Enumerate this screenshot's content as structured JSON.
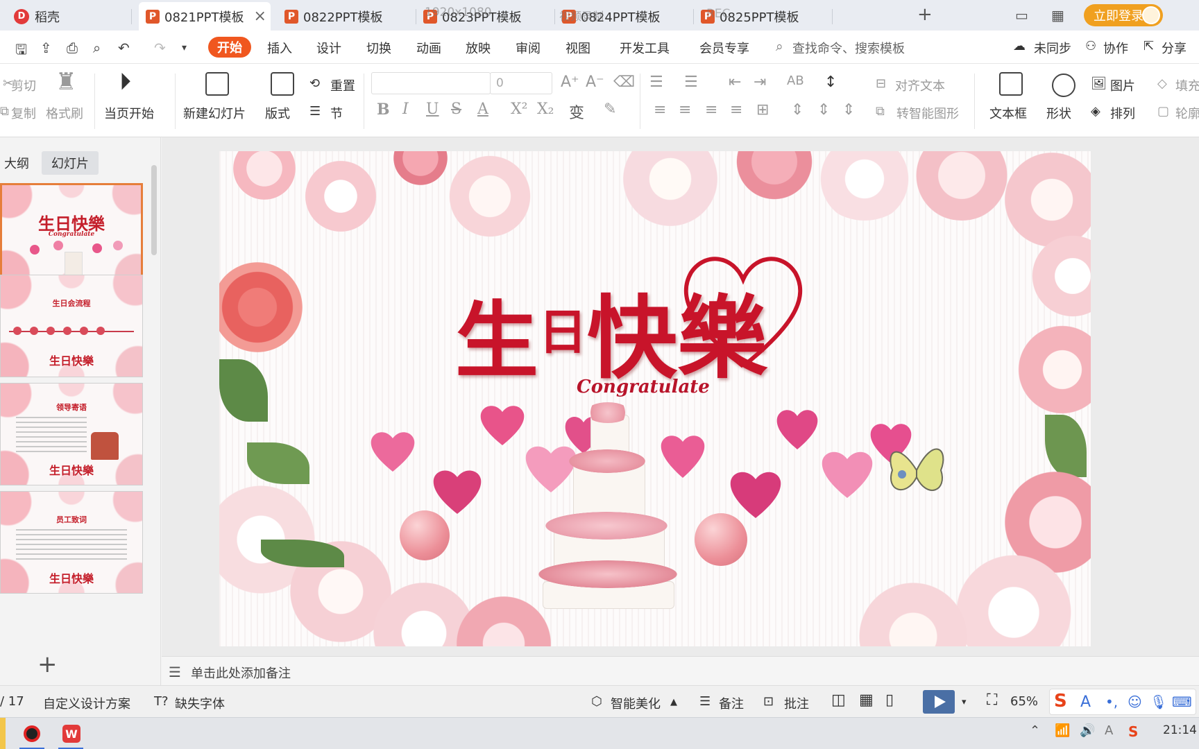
{
  "tabs": [
    {
      "label": "稻壳",
      "type": "docer"
    },
    {
      "label": "0821PPT模板",
      "type": "ppt",
      "active": true
    },
    {
      "label": "0822PPT模板",
      "type": "ppt"
    },
    {
      "label": "0823PPT模板",
      "type": "ppt"
    },
    {
      "label": "0824PPT模板",
      "type": "ppt"
    },
    {
      "label": "0825PPT模板",
      "type": "ppt"
    }
  ],
  "tab_close_icon": "×",
  "overlay": {
    "resolution": "1920x1080",
    "recording": "视频录制",
    "rec": "REC"
  },
  "titlebar": {
    "new_tab": "+",
    "login": "立即登录"
  },
  "menu": [
    "开始",
    "插入",
    "设计",
    "切换",
    "动画",
    "放映",
    "审阅",
    "视图",
    "开发工具",
    "会员专享"
  ],
  "search": {
    "placeholder": "查找命令、搜索模板"
  },
  "menu_right": {
    "sync": "未同步",
    "collab": "协作",
    "share": "分享"
  },
  "ribbon": {
    "cut": "剪切",
    "copy": "复制",
    "format_painter": "格式刷",
    "from_current": "当页开始",
    "new_slide": "新建幻灯片",
    "layout": "版式",
    "reset": "重置",
    "section": "节",
    "font_name": "",
    "font_size": "0",
    "align_text": "对齐文本",
    "smart_art": "转智能图形",
    "text_box": "文本框",
    "shape": "形状",
    "picture": "图片",
    "arrange": "排列",
    "fill": "填充",
    "outline": "轮廓"
  },
  "panel": {
    "outline_tab": "大纲",
    "slides_tab": "幻灯片",
    "add": "+"
  },
  "thumbnails": [
    {
      "title": "生日快樂",
      "subtitle": "Congratulate"
    },
    {
      "title": "生日会流程",
      "footer": "生日快樂"
    },
    {
      "title": "领导寄语",
      "footer": "生日快樂"
    },
    {
      "title": "员工致词",
      "footer": "生日快樂"
    }
  ],
  "slide": {
    "title_part1": "生",
    "title_part2": "日",
    "title_part3": "快樂",
    "subtitle": "Congratulate"
  },
  "notes": {
    "placeholder": "单击此处添加备注"
  },
  "status": {
    "page": "/ 17",
    "design": "自定义设计方案",
    "missing_font": "缺失字体",
    "beautify": "智能美化",
    "notes": "备注",
    "comment": "批注",
    "zoom": "65%"
  },
  "taskbar": {
    "time": "21:14"
  },
  "colors": {
    "accent": "#f0571f",
    "login": "#f0a020",
    "title_red": "#c8142a"
  }
}
